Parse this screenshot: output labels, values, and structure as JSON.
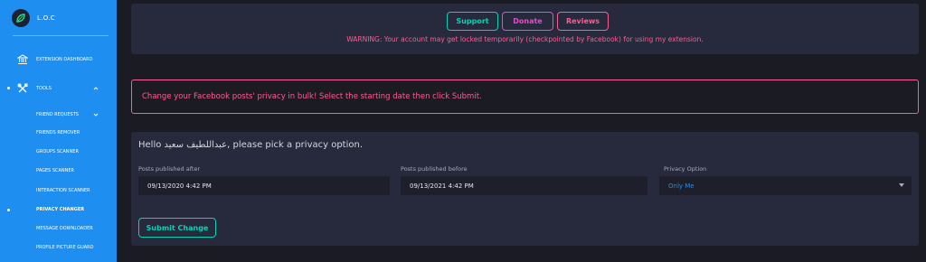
{
  "brand": {
    "title": "L.O.C",
    "logo_icon": "leaf-logo-icon"
  },
  "sidebar": {
    "dashboard": {
      "label": "EXTENSION DASHBOARD",
      "icon": "bank-icon"
    },
    "tools": {
      "label": "TOOLS",
      "icon": "tools-icon",
      "expanded": true
    },
    "friend_requests": {
      "label": "FRIEND REQUESTS",
      "collapsed": true
    },
    "subitems": [
      {
        "label": "FRIENDS REMOVER"
      },
      {
        "label": "GROUPS SCANNER"
      },
      {
        "label": "PAGES SCANNER"
      },
      {
        "label": "INTERACTION SCANNER"
      },
      {
        "label": "PRIVACY CHANGER",
        "active": true
      },
      {
        "label": "MESSAGE DOWNLOADER"
      },
      {
        "label": "PROFILE PICTURE GUARD"
      }
    ],
    "accent": "#1f8ef1"
  },
  "header": {
    "support_label": "Support",
    "donate_label": "Donate",
    "reviews_label": "Reviews",
    "warning": "WARNING: Your account may get locked temporarily (checkpointed by Facebook) for using my extension."
  },
  "alert": {
    "text": "Change your Facebook posts' privacy in bulk! Select the starting date then click Submit."
  },
  "form": {
    "greeting": "Hello عبداللطيف سعيد, please pick a privacy option.",
    "after": {
      "label": "Posts published after",
      "value": "09/13/2020 4:42 PM"
    },
    "before": {
      "label": "Posts published before",
      "value": "09/13/2021 4:42 PM"
    },
    "privacy": {
      "label": "Privacy Option",
      "value": "Only Me"
    },
    "submit_label": "Submit Change"
  },
  "colors": {
    "teal": "#00d6b4",
    "magenta": "#e14eca",
    "pink": "#fd5d93",
    "panel": "#27293d",
    "background": "#1b1c23"
  }
}
